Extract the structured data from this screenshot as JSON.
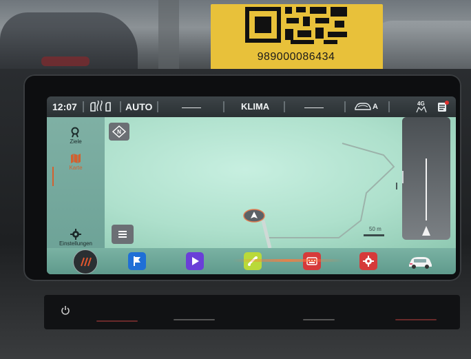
{
  "sticker": {
    "number": "989000086434"
  },
  "status_bar": {
    "time": "12:07",
    "climate_mode": "AUTO",
    "left_temp": "——",
    "center_label": "KLIMA",
    "right_temp": "——",
    "recirc_label": "A",
    "network": "4G",
    "icons": [
      "seat-heat-icon",
      "fan-icon",
      "car-recirc-icon",
      "notification-icon"
    ]
  },
  "rail": {
    "items": [
      {
        "label": "Ziele",
        "icon": "search-icon"
      },
      {
        "label": "Karte",
        "icon": "map-icon",
        "active": true
      },
      {
        "label": "Einstellungen",
        "icon": "gear-icon"
      }
    ]
  },
  "map": {
    "compass_icon": "north-compass-icon",
    "menu_icon": "hamburger-icon",
    "scale": "50 m"
  },
  "dock": {
    "apps": [
      {
        "name": "nav-app",
        "color": "#1f6fd6"
      },
      {
        "name": "media-app",
        "color": "#6a3fd8"
      },
      {
        "name": "phone-app",
        "color": "#b9d93a"
      },
      {
        "name": "keyboard-app",
        "color": "#d63a3a"
      },
      {
        "name": "settings-app",
        "color": "#d63a3a"
      }
    ]
  },
  "colors": {
    "accent": "#d4602e",
    "map_green": "#aee0cc"
  }
}
